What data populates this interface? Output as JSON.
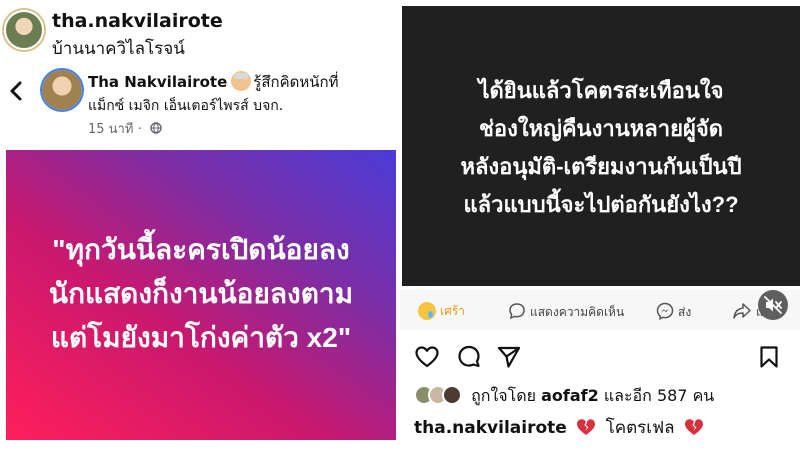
{
  "instagram": {
    "username": "tha.nakvilairote",
    "location": "บ้านนาควิไลโรจน์"
  },
  "fb_post": {
    "author": "Tha Nakvilairote",
    "feeling": "รู้สึกคิดหนักที่",
    "page": "แม็กซ์ เมจิก เอ็นเตอร์ไพรส์ บจก.",
    "time": "15 นาที ·",
    "text_lines": [
      "\"ทุกวันนี้ละครเปิดน้อยลง",
      "นักแสดงก็งานน้อยลงตาม",
      "แต่โมยังมาโก่งค่าตัว x2\""
    ]
  },
  "right_post": {
    "text_lines": [
      "ได้ยินแล้วโคตรสะเทือนใจ",
      "ช่องใหญ่คืนงานหลายผู้จัด",
      "หลังอนุมัติ-เตรียมงานกันเป็นปี",
      "แล้วแบบนี้จะไปต่อกันยังไง??"
    ],
    "actions": {
      "reaction": "เศร้า",
      "comment": "แสดงความคิดเห็น",
      "send": "ส่ง",
      "share": "แชร์"
    }
  },
  "ig_footer": {
    "likes_prefix": "ถูกใจโดย",
    "likes_user": "aofaf2",
    "likes_suffix": "และอีก 587 คน",
    "caption_user": "tha.nakvilairote",
    "caption_text": "โคตรเฟล"
  },
  "colors": {
    "card_gradient": [
      "#ff1f5a",
      "#4b3bd6"
    ],
    "dark_card": "#202020",
    "broken_heart": "#d9303e"
  },
  "icons": [
    "avatar",
    "back-icon",
    "globe-icon",
    "sad-reaction-icon",
    "comment-icon",
    "messenger-icon",
    "share-icon",
    "mute-icon",
    "heart-icon",
    "ig-comment-icon",
    "paper-plane-icon",
    "bookmark-icon",
    "broken-heart-icon"
  ]
}
